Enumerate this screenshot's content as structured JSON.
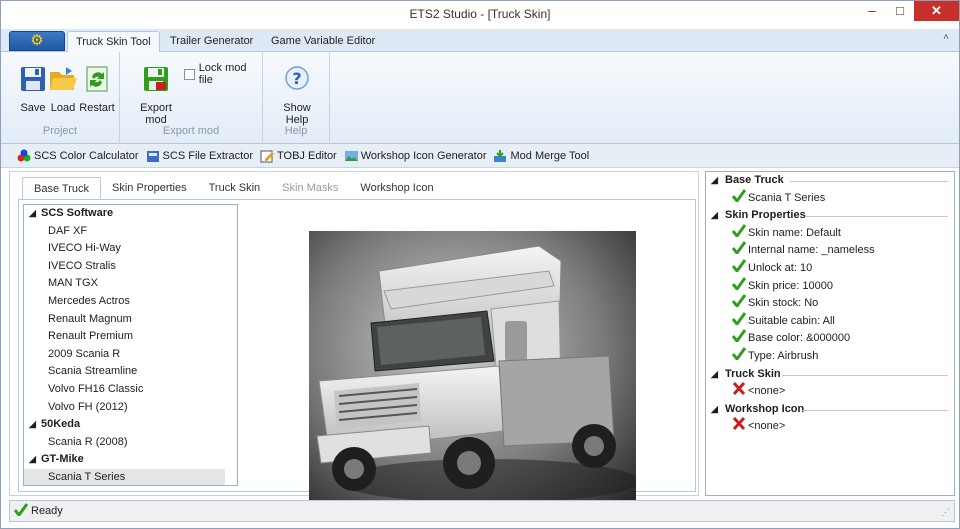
{
  "window": {
    "title": "ETS2 Studio - [Truck Skin]"
  },
  "ribbon_tabs": [
    "Truck Skin Tool",
    "Trailer Generator",
    "Game Variable Editor"
  ],
  "ribbon": {
    "project": {
      "label": "Project",
      "save": "Save",
      "load": "Load",
      "restart": "Restart"
    },
    "export": {
      "label": "Export mod",
      "export_mod": "Export mod",
      "lock_mod": "Lock mod file"
    },
    "help": {
      "label": "Help",
      "show_help": "Show Help"
    }
  },
  "toolbar": [
    "SCS Color Calculator",
    "SCS File Extractor",
    "TOBJ Editor",
    "Workshop Icon Generator",
    "Mod Merge Tool"
  ],
  "content_tabs": [
    "Base Truck",
    "Skin Properties",
    "Truck Skin",
    "Skin Masks",
    "Workshop Icon"
  ],
  "truck_list": {
    "groups": [
      {
        "name": "SCS Software",
        "items": [
          "DAF XF",
          "IVECO Hi-Way",
          "IVECO Stralis",
          "MAN TGX",
          "Mercedes Actros",
          "Renault Magnum",
          "Renault Premium",
          "2009 Scania R",
          "Scania Streamline",
          "Volvo FH16 Classic",
          "Volvo FH (2012)"
        ]
      },
      {
        "name": "50Keda",
        "items": [
          "Scania R (2008)"
        ]
      },
      {
        "name": "GT-Mike",
        "items": [
          "Scania T Series"
        ]
      }
    ],
    "selected": "Scania T Series"
  },
  "properties": {
    "base_truck": {
      "title": "Base Truck",
      "items": [
        "Scania T Series"
      ]
    },
    "skin_properties": {
      "title": "Skin Properties",
      "items": [
        "Skin name: Default",
        "Internal name: _nameless",
        "Unlock at: 10",
        "Skin price: 10000",
        "Skin stock: No",
        "Suitable cabin: All",
        "Base color: &000000",
        "Type: Airbrush"
      ]
    },
    "truck_skin": {
      "title": "Truck Skin",
      "items": [
        "<none>"
      ]
    },
    "workshop_icon": {
      "title": "Workshop Icon",
      "items": [
        "<none>"
      ]
    }
  },
  "status": {
    "text": "Ready"
  },
  "colors": {
    "accent": "#1f56a6",
    "ok": "#2f9e1c",
    "error": "#c62020",
    "close": "#c7302a"
  }
}
